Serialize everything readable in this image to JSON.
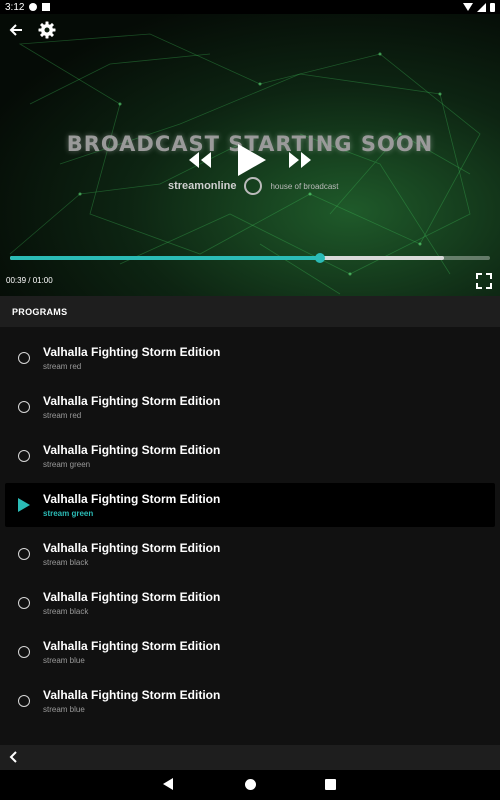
{
  "status_bar": {
    "time": "3:12"
  },
  "player": {
    "banner_title": "BROADCAST STARTING SOON",
    "brand_text": "streamonline",
    "brand_tagline": "house of broadcast",
    "time_label": "00:39 / 01:00",
    "progress_played": 0.645,
    "progress_buffered": 0.905,
    "accent_color": "#2bbbb6"
  },
  "programs": {
    "header": "PROGRAMS",
    "items": [
      {
        "title": "Valhalla Fighting Storm Edition",
        "subtitle": "stream red",
        "active": false
      },
      {
        "title": "Valhalla Fighting Storm Edition",
        "subtitle": "stream red",
        "active": false
      },
      {
        "title": "Valhalla Fighting Storm Edition",
        "subtitle": "stream green",
        "active": false
      },
      {
        "title": "Valhalla Fighting Storm Edition",
        "subtitle": "stream green",
        "active": true
      },
      {
        "title": "Valhalla Fighting Storm Edition",
        "subtitle": "stream black",
        "active": false
      },
      {
        "title": "Valhalla Fighting Storm Edition",
        "subtitle": "stream black",
        "active": false
      },
      {
        "title": "Valhalla Fighting Storm Edition",
        "subtitle": "stream blue",
        "active": false
      },
      {
        "title": "Valhalla Fighting Storm Edition",
        "subtitle": "stream blue",
        "active": false
      }
    ]
  },
  "icons": {
    "back": "arrow-left-icon",
    "settings": "gear-icon",
    "rewind": "rewind-icon",
    "play": "play-icon",
    "fast_forward": "fast-forward-icon",
    "fullscreen": "fullscreen-icon",
    "collapse": "chevron-left-icon"
  }
}
